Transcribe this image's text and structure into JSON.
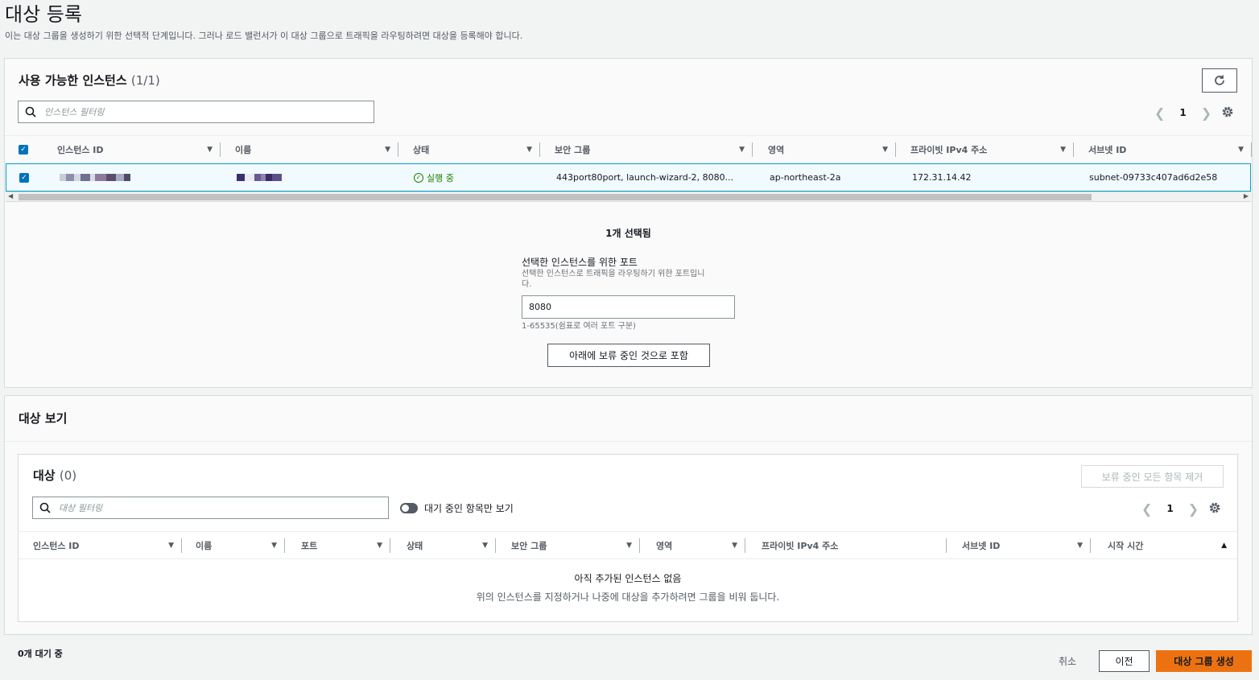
{
  "page": {
    "title": "대상 등록",
    "description": "이는 대상 그룹을 생성하기 위한 선택적 단계입니다. 그러나 로드 밸런서가 이 대상 그룹으로 트래픽을 라우팅하려면 대상을 등록해야 합니다."
  },
  "available": {
    "title": "사용 가능한 인스턴스",
    "count": "(1/1)",
    "search_placeholder": "인스턴스 필터링",
    "page_number": "1",
    "columns": [
      "인스턴스 ID",
      "이름",
      "상태",
      "보안 그룹",
      "영역",
      "프라이빗 IPv4 주소",
      "서브넷 ID"
    ],
    "row": {
      "status": "실행 중",
      "security_groups": "443port80port, launch-wizard-2, 8080...",
      "zone": "ap-northeast-2a",
      "private_ip": "172.31.14.42",
      "subnet_id": "subnet-09733c407ad6d2e58"
    },
    "scroll_position": 0.88
  },
  "selection": {
    "selected_text": "1개 선택됨",
    "port_label": "선택한 인스턴스를 위한 포트",
    "port_hint_line1": "선택한 인스턴스로 트래픽을 라우팅하기 위한 포트입니",
    "port_hint_line2": "다.",
    "port_value": "8080",
    "port_range": "1-65535(쉼표로 여러 포트 구분)",
    "include_button": "아래에 보류 중인 것으로 포함"
  },
  "review": {
    "title": "대상 보기",
    "targets_title": "대상",
    "targets_count": "(0)",
    "remove_all_button": "보류 중인 모든 항목 제거",
    "search_placeholder": "대상 필터링",
    "toggle_label": "대기 중인 항목만 보기",
    "page_number": "1",
    "columns": [
      "인스턴스 ID",
      "이름",
      "포트",
      "상태",
      "보안 그룹",
      "영역",
      "프라이빗 IPv4 주소",
      "서브넷 ID",
      "시작 시간"
    ],
    "empty_title": "아직 추가된 인스턴스 없음",
    "empty_desc": "위의 인스턴스를 지정하거나 나중에 대상을 추가하려면 그룹을 비워 둡니다."
  },
  "footer": {
    "pending": "0개 대기 중",
    "cancel": "취소",
    "previous": "이전",
    "create": "대상 그룹 생성"
  },
  "colors": {
    "accent": "#0073bb",
    "primary": "#ec7211",
    "success": "#1d8102"
  }
}
